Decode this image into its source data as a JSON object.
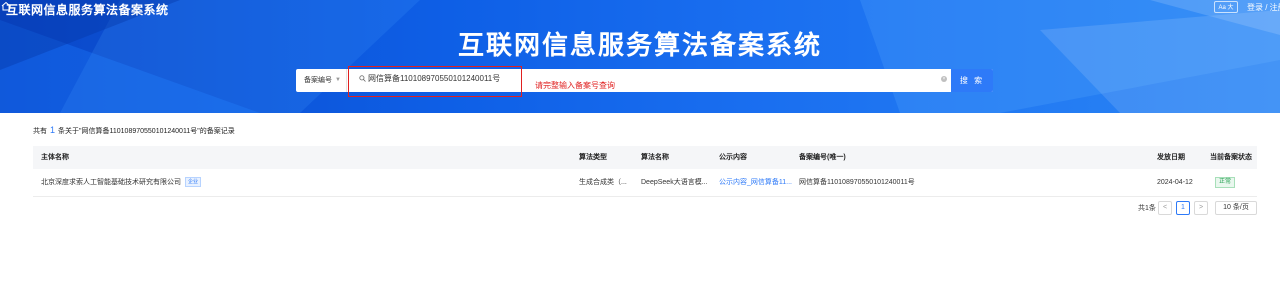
{
  "header": {
    "brand": "互联网信息服务算法备案系统",
    "lang_label": "Aa 大",
    "login_label": "登录 / 注册"
  },
  "hero": {
    "title": "互联网信息服务算法备案系统"
  },
  "search": {
    "field_select": "备案编号",
    "value": "网信算备110108970550101240011号",
    "button_label": "搜 索",
    "hint": "请完整输入备案号查询"
  },
  "summary": {
    "prefix": "共有",
    "count": "1",
    "suffix": "条关于\"网信算备110108970550101240011号\"的备案记录"
  },
  "table": {
    "headers": [
      "主体名称",
      "算法类型",
      "算法名称",
      "公示内容",
      "备案编号(唯一)",
      "发放日期",
      "当前备案状态"
    ],
    "rows": [
      {
        "entity": "北京深度求索人工智能基础技术研究有限公司",
        "entity_tag": "企业",
        "algo_type": "生成合成类（...",
        "algo_name": "DeepSeek大语言模...",
        "public_content": "公示内容_网信算备11...",
        "record_no": "网信算备110108970550101240011号",
        "date": "2024-04-12",
        "status": "正常"
      }
    ]
  },
  "pagination": {
    "total": "共1条",
    "prev": "<",
    "current": "1",
    "next": ">",
    "page_size": "10 条/页"
  }
}
